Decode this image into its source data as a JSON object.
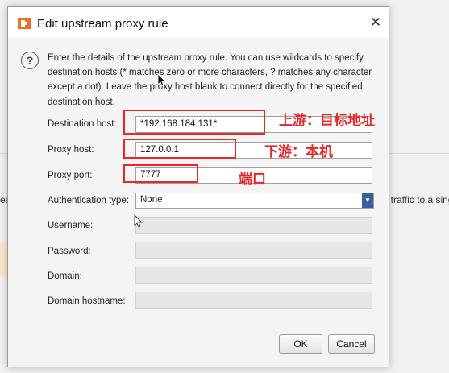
{
  "background": {
    "left_fragment": "est",
    "right_fragment": "ll traffic to a sing"
  },
  "dialog": {
    "title": "Edit upstream proxy rule",
    "close_glyph": "✕",
    "help_glyph": "?",
    "description": "Enter the details of the upstream proxy rule. You can use wildcards to specify destination hosts (* matches zero or more characters, ? matches any character except a dot). Leave the proxy host blank to connect directly for the specified destination host.",
    "fields": {
      "destination_host": {
        "label": "Destination host:",
        "value": "*192.168.184.131*"
      },
      "proxy_host": {
        "label": "Proxy host:",
        "value": "127.0.0.1"
      },
      "proxy_port": {
        "label": "Proxy port:",
        "value": "7777"
      },
      "authentication_type": {
        "label": "Authentication type:",
        "value": "None"
      },
      "username": {
        "label": "Username:",
        "value": ""
      },
      "password": {
        "label": "Password:",
        "value": ""
      },
      "domain": {
        "label": "Domain:",
        "value": ""
      },
      "domain_hostname": {
        "label": "Domain hostname:",
        "value": ""
      }
    },
    "buttons": {
      "ok": "OK",
      "cancel": "Cancel"
    }
  },
  "annotations": {
    "destination": "上游：目标地址",
    "proxy": "下游：本机",
    "port": "端口"
  },
  "colors": {
    "annotation_red": "#e8272a",
    "select_arrow_blue": "#3b5e9b"
  }
}
